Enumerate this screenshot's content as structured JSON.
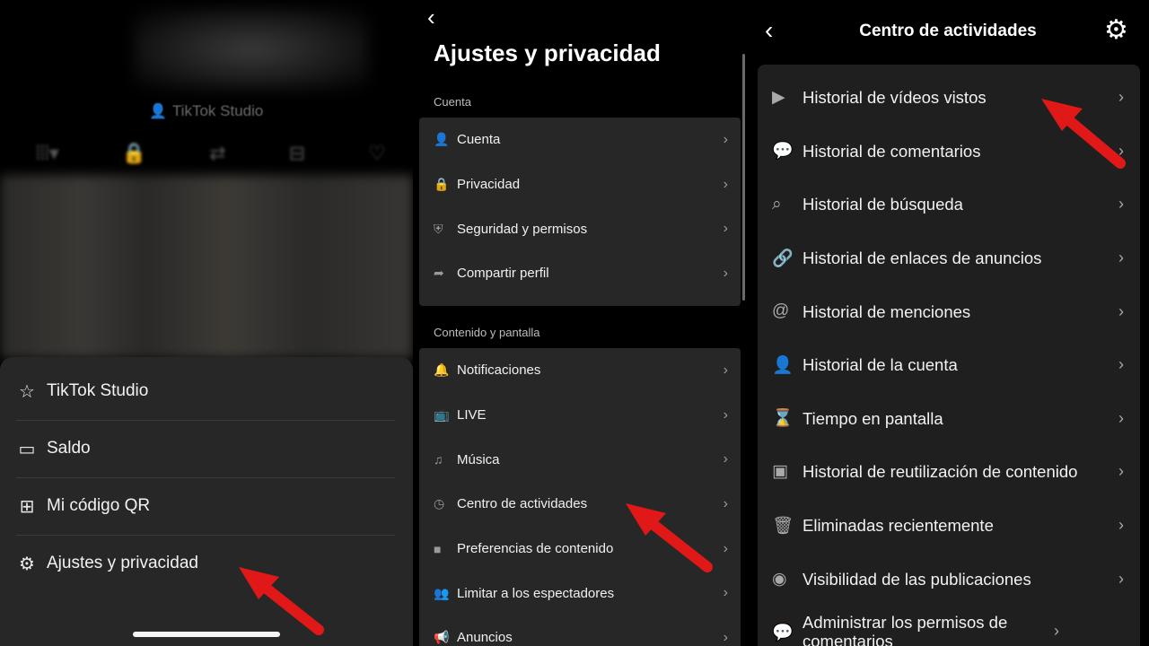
{
  "panel1": {
    "studio_top": "TikTok Studio",
    "top_icons": [
      "grid-icon",
      "lock-icon",
      "repost-icon",
      "bookmark-icon",
      "heart-icon"
    ],
    "sheet_items": [
      {
        "icon": "creator-star-icon",
        "glyph": "👤",
        "label": "TikTok Studio"
      },
      {
        "icon": "wallet-icon",
        "glyph": "▭",
        "label": "Saldo"
      },
      {
        "icon": "qr-code-icon",
        "glyph": "⊞",
        "label": "Mi código QR"
      },
      {
        "icon": "gear-icon",
        "glyph": "⚙",
        "label": "Ajustes y privacidad"
      }
    ]
  },
  "panel2": {
    "back": "‹",
    "title": "Ajustes y privacidad",
    "section_account": "Cuenta",
    "account_items": [
      {
        "icon": "person-icon",
        "glyph": "👤",
        "label": "Cuenta"
      },
      {
        "icon": "lock-icon",
        "glyph": "🔒",
        "label": "Privacidad"
      },
      {
        "icon": "shield-icon",
        "glyph": "⛨",
        "label": "Seguridad y permisos"
      },
      {
        "icon": "share-icon",
        "glyph": "➦",
        "label": "Compartir perfil"
      }
    ],
    "section_content": "Contenido y pantalla",
    "content_items": [
      {
        "icon": "bell-icon",
        "glyph": "🔔",
        "label": "Notificaciones"
      },
      {
        "icon": "live-tv-icon",
        "glyph": "📺",
        "label": "LIVE"
      },
      {
        "icon": "music-note-icon",
        "glyph": "♫",
        "label": "Música"
      },
      {
        "icon": "clock-icon",
        "glyph": "◷",
        "label": "Centro de actividades"
      },
      {
        "icon": "video-camera-icon",
        "glyph": "■",
        "label": "Preferencias de contenido"
      },
      {
        "icon": "people-icon",
        "glyph": "👥",
        "label": "Limitar a los espectadores"
      },
      {
        "icon": "megaphone-icon",
        "glyph": "📢",
        "label": "Anuncios"
      }
    ]
  },
  "panel3": {
    "title": "Centro de actividades",
    "items": [
      {
        "icon": "play-circle-icon",
        "glyph": "▶",
        "label": "Historial de vídeos vistos"
      },
      {
        "icon": "comment-icon",
        "glyph": "💬",
        "label": "Historial de comentarios"
      },
      {
        "icon": "search-icon",
        "glyph": "⌕",
        "label": "Historial de búsqueda"
      },
      {
        "icon": "link-icon",
        "glyph": "🔗",
        "label": "Historial de enlaces de anuncios"
      },
      {
        "icon": "at-sign-icon",
        "glyph": "@",
        "label": "Historial de menciones"
      },
      {
        "icon": "person-icon",
        "glyph": "👤",
        "label": "Historial de la cuenta"
      },
      {
        "icon": "hourglass-icon",
        "glyph": "⌛",
        "label": "Tiempo en pantalla"
      },
      {
        "icon": "video-reuse-icon",
        "glyph": "▣",
        "label": "Historial de reutilización de contenido"
      },
      {
        "icon": "trash-icon",
        "glyph": "🗑",
        "label": "Eliminadas recientemente"
      },
      {
        "icon": "eye-icon",
        "glyph": "◉",
        "label": "Visibilidad de las publicaciones"
      },
      {
        "icon": "comment-settings-icon",
        "glyph": "💬",
        "label": "Administrar los permisos de comentarios"
      }
    ]
  },
  "colors": {
    "background": "#000000",
    "sheet": "#272727",
    "group": "#272727",
    "annotation_arrow": "#e01818",
    "secondary_text": "#bdbdbd"
  }
}
